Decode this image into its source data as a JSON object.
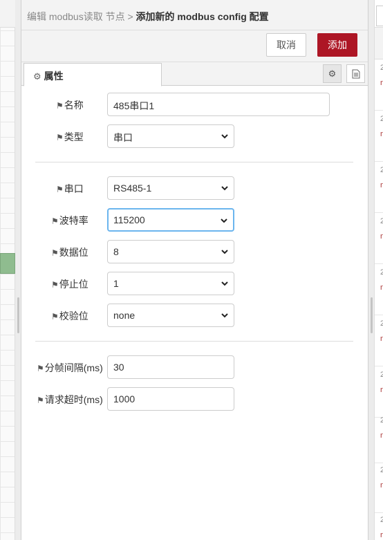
{
  "breadcrumb": {
    "prefix": "编辑 modbus读取 节点 > ",
    "current": "添加新的 modbus config 配置"
  },
  "toolbar": {
    "cancel_label": "取消",
    "add_label": "添加"
  },
  "tabs": {
    "properties_label": "属性"
  },
  "form": {
    "name": {
      "label": "名称",
      "value": "485串口1"
    },
    "type": {
      "label": "类型",
      "value": "串口"
    },
    "serial_port": {
      "label": "串口",
      "value": "RS485-1"
    },
    "baud_rate": {
      "label": "波特率",
      "value": "115200"
    },
    "data_bits": {
      "label": "数据位",
      "value": "8"
    },
    "stop_bits": {
      "label": "停止位",
      "value": "1"
    },
    "parity": {
      "label": "校验位",
      "value": "none"
    },
    "frame_interval": {
      "label": "分帧间隔(ms)",
      "value": "30"
    },
    "request_timeout": {
      "label": "请求超时(ms)",
      "value": "1000"
    }
  },
  "colors": {
    "primary_button": "#ad1625",
    "focus_ring": "#6bb5ee",
    "header_bg": "#f3f3f3"
  },
  "debug_strip": {
    "date_glyph": "2",
    "node_glyph": "n"
  }
}
